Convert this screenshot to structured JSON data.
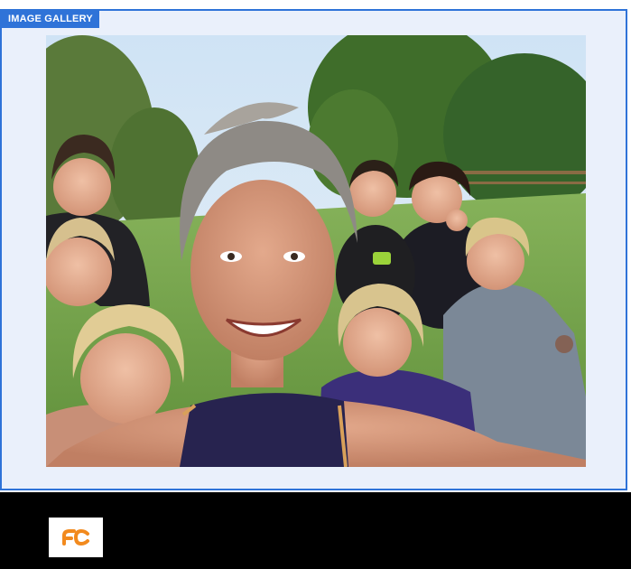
{
  "gallery": {
    "label": "IMAGE GALLERY",
    "photo": {
      "alt_subject": "group-selfie-outdoors"
    }
  },
  "footer": {
    "logo_icon": "fc-logo-icon",
    "logo_color": "#f28a1e"
  },
  "colors": {
    "accent": "#2f73d8",
    "gallery_background": "#eaf0fb",
    "footer_background": "#000000"
  }
}
